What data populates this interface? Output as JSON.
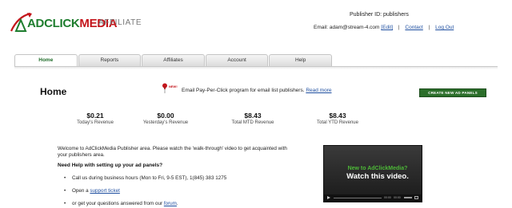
{
  "brand": {
    "name_ad": "AD",
    "name_click": "CLICK",
    "name_media": "MEDIA",
    "subtitle": "AFFILIATE",
    "green": "#1e7d2e",
    "red": "#c4161c"
  },
  "account": {
    "publisher_id_label": "Publisher ID: publishers",
    "email_label": "Email: adam@stream-4.com",
    "edit_link": "[Edit]",
    "separator": "|",
    "contact_link": "Contact",
    "logout_link": "Log Out"
  },
  "nav": {
    "tabs": [
      "Home",
      "Reports",
      "Affiliates",
      "Account",
      "Help"
    ],
    "active_tab": "Home"
  },
  "page": {
    "title": "Home",
    "news": {
      "badge": "NEW!",
      "text": "Email Pay-Per-Click program for email list publishers.",
      "link": "Read more"
    },
    "create_button": "CREATE NEW AD PANELS"
  },
  "stats": [
    {
      "value": "$0.21",
      "label": "Today's Revenue"
    },
    {
      "value": "$0.00",
      "label": "Yesterday's Revenue"
    },
    {
      "value": "$8.43",
      "label": "Total MTD Revenue"
    },
    {
      "value": "$8.43",
      "label": "Total YTD Revenue"
    }
  ],
  "welcome": {
    "text": "Welcome to AdClickMedia Publisher area. Please watch the 'walk-through' video to get acquainted with your publishers area.",
    "help_heading": "Need Help with setting up your ad panels?",
    "bullet1": "Call us during business hours (Mon to Fri, 9-5 EST), 1(845) 383 1275",
    "bullet2_prefix": "Open a ",
    "bullet2_link": "support ticket",
    "bullet3_prefix": "or get your questions answered from our ",
    "bullet3_link": "forum",
    "bullet3_suffix": "."
  },
  "video": {
    "line1": "New to AdClickMedia?",
    "line2": "Watch this video.",
    "time_elapsed": "00:00",
    "time_total": "00:00"
  }
}
